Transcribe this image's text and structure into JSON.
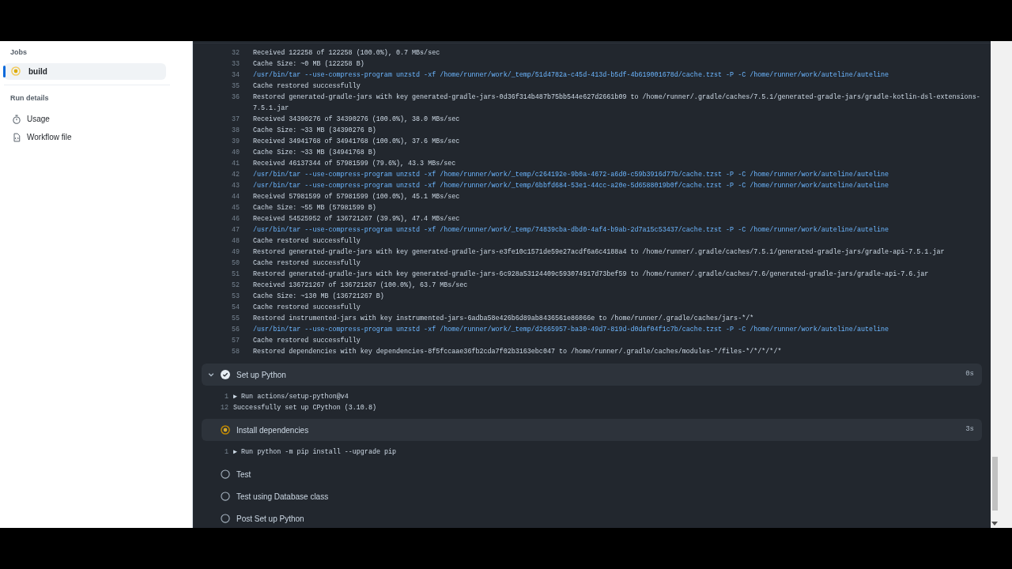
{
  "sidebar": {
    "jobs_heading": "Jobs",
    "jobs": [
      {
        "name": "build",
        "kind": "in_progress",
        "selected": true
      }
    ],
    "run_details_heading": "Run details",
    "links": [
      {
        "label": "Usage",
        "kind": "usage"
      },
      {
        "label": "Workflow file",
        "kind": "workflow"
      }
    ]
  },
  "log": {
    "lines": [
      {
        "number": "32",
        "kind": "output",
        "text": "Received 122258 of 122258 (100.0%), 0.7 MBs/sec"
      },
      {
        "number": "33",
        "kind": "output",
        "text": "Cache Size: ~0 MB (122258 B)"
      },
      {
        "number": "34",
        "kind": "command",
        "text": "/usr/bin/tar --use-compress-program unzstd -xf /home/runner/work/_temp/51d4782a-c45d-413d-b5df-4b619001678d/cache.tzst -P -C /home/runner/work/auteline/auteline"
      },
      {
        "number": "35",
        "kind": "output",
        "text": "Cache restored successfully"
      },
      {
        "number": "36",
        "kind": "output",
        "text": "Restored generated-gradle-jars with key generated-gradle-jars-0d36f314b487b75bb544e627d2661b09 to /home/runner/.gradle/caches/7.5.1/generated-gradle-jars/gradle-kotlin-dsl-extensions-7.5.1.jar"
      },
      {
        "number": "37",
        "kind": "output",
        "text": "Received 34390276 of 34390276 (100.0%), 38.0 MBs/sec"
      },
      {
        "number": "38",
        "kind": "output",
        "text": "Cache Size: ~33 MB (34390276 B)"
      },
      {
        "number": "39",
        "kind": "output",
        "text": "Received 34941768 of 34941768 (100.0%), 37.6 MBs/sec"
      },
      {
        "number": "40",
        "kind": "output",
        "text": "Cache Size: ~33 MB (34941768 B)"
      },
      {
        "number": "41",
        "kind": "output",
        "text": "Received 46137344 of 57981599 (79.6%), 43.3 MBs/sec"
      },
      {
        "number": "42",
        "kind": "command",
        "text": "/usr/bin/tar --use-compress-program unzstd -xf /home/runner/work/_temp/c264192e-9b0a-4672-a6d0-c59b3916d77b/cache.tzst -P -C /home/runner/work/auteline/auteline"
      },
      {
        "number": "43",
        "kind": "command",
        "text": "/usr/bin/tar --use-compress-program unzstd -xf /home/runner/work/_temp/6bbfd684-53e1-44cc-a20e-5d6588019b0f/cache.tzst -P -C /home/runner/work/auteline/auteline"
      },
      {
        "number": "44",
        "kind": "output",
        "text": "Received 57981599 of 57981599 (100.0%), 45.1 MBs/sec"
      },
      {
        "number": "45",
        "kind": "output",
        "text": "Cache Size: ~55 MB (57981599 B)"
      },
      {
        "number": "46",
        "kind": "output",
        "text": "Received 54525952 of 136721267 (39.9%), 47.4 MBs/sec"
      },
      {
        "number": "47",
        "kind": "command",
        "text": "/usr/bin/tar --use-compress-program unzstd -xf /home/runner/work/_temp/74839cba-dbd0-4af4-b9ab-2d7a15c53437/cache.tzst -P -C /home/runner/work/auteline/auteline"
      },
      {
        "number": "48",
        "kind": "output",
        "text": "Cache restored successfully"
      },
      {
        "number": "49",
        "kind": "output",
        "text": "Restored generated-gradle-jars with key generated-gradle-jars-e3fe10c1571de59e27acdf6a6c4188a4 to /home/runner/.gradle/caches/7.5.1/generated-gradle-jars/gradle-api-7.5.1.jar"
      },
      {
        "number": "50",
        "kind": "output",
        "text": "Cache restored successfully"
      },
      {
        "number": "51",
        "kind": "output",
        "text": "Restored generated-gradle-jars with key generated-gradle-jars-6c928a53124409c593074917d73bef59 to /home/runner/.gradle/caches/7.6/generated-gradle-jars/gradle-api-7.6.jar"
      },
      {
        "number": "52",
        "kind": "output",
        "text": "Received 136721267 of 136721267 (100.0%), 63.7 MBs/sec"
      },
      {
        "number": "53",
        "kind": "output",
        "text": "Cache Size: ~130 MB (136721267 B)"
      },
      {
        "number": "54",
        "kind": "output",
        "text": "Cache restored successfully"
      },
      {
        "number": "55",
        "kind": "output",
        "text": "Restored instrumented-jars with key instrumented-jars-6adba58e426b6d89ab8436561e86066e to /home/runner/.gradle/caches/jars-*/*"
      },
      {
        "number": "56",
        "kind": "command",
        "text": "/usr/bin/tar --use-compress-program unzstd -xf /home/runner/work/_temp/d2665957-ba30-49d7-819d-d0daf04f1c7b/cache.tzst -P -C /home/runner/work/auteline/auteline"
      },
      {
        "number": "57",
        "kind": "output",
        "text": "Cache restored successfully"
      },
      {
        "number": "58",
        "kind": "output",
        "text": "Restored dependencies with key dependencies-8f5fccaae36fb2cda7f02b3163ebc047 to /home/runner/.gradle/caches/modules-*/files-*/*/*/*/*"
      }
    ]
  },
  "steps": [
    {
      "name": "Set up Python",
      "kind": "success",
      "expanded": true,
      "hovered": true,
      "duration": "0s",
      "lines": [
        {
          "number": "1",
          "text": "▶ Run actions/setup-python@v4"
        },
        {
          "number": "12",
          "text": "Successfully set up CPython (3.10.8)"
        }
      ]
    },
    {
      "name": "Install dependencies",
      "kind": "in_progress",
      "expanded": true,
      "hovered": false,
      "duration": "3s",
      "lines": [
        {
          "number": "1",
          "text": "▶ Run python -m pip install --upgrade pip"
        }
      ]
    },
    {
      "name": "Test",
      "kind": "pending",
      "expanded": false,
      "hovered": false
    },
    {
      "name": "Test using Database class",
      "kind": "pending",
      "expanded": false,
      "hovered": false
    },
    {
      "name": "Post Set up Python",
      "kind": "pending",
      "expanded": false,
      "hovered": false
    }
  ]
}
